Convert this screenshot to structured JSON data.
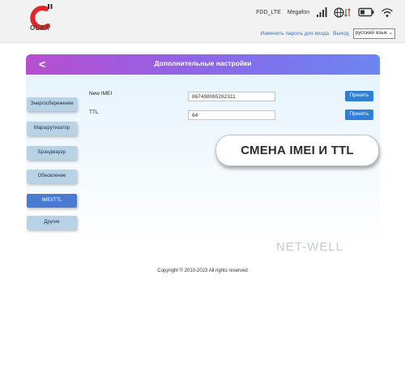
{
  "brand": {
    "logo_text": "OLAX"
  },
  "status": {
    "network_label": "FDD_LTE",
    "operator": "Megafon"
  },
  "top_links": {
    "change_password": "Изменить пароль для входа",
    "logout": "Выход",
    "language": "русский язык"
  },
  "panel": {
    "title": "Дополнительные настройки"
  },
  "sidebar": {
    "items": [
      {
        "label": "Энергосбережение",
        "active": false
      },
      {
        "label": "Маршрутизатор",
        "active": false
      },
      {
        "label": "Брэндмауэр",
        "active": false
      },
      {
        "label": "Обновление",
        "active": false
      },
      {
        "label": "IMEI/TTL",
        "active": true
      },
      {
        "label": "Другие",
        "active": false
      }
    ]
  },
  "form": {
    "imei": {
      "label": "New IMEI",
      "value": "867498065262311",
      "button": "Принять"
    },
    "ttl": {
      "label": "TTL",
      "value": "64",
      "button": "Принять"
    }
  },
  "overlay": {
    "banner": "СМЕНА IMEI И TTL",
    "watermark": "NET-WELL"
  },
  "footer": {
    "copyright": "Copyright © 2010-2023 All rights reserved"
  },
  "colors": {
    "header_gradient_start": "#b64fd0",
    "header_gradient_end": "#6d86f0",
    "sidebar_active": "#4a7bd4",
    "accept_button": "#2f7fd5",
    "link": "#3a74b8"
  }
}
